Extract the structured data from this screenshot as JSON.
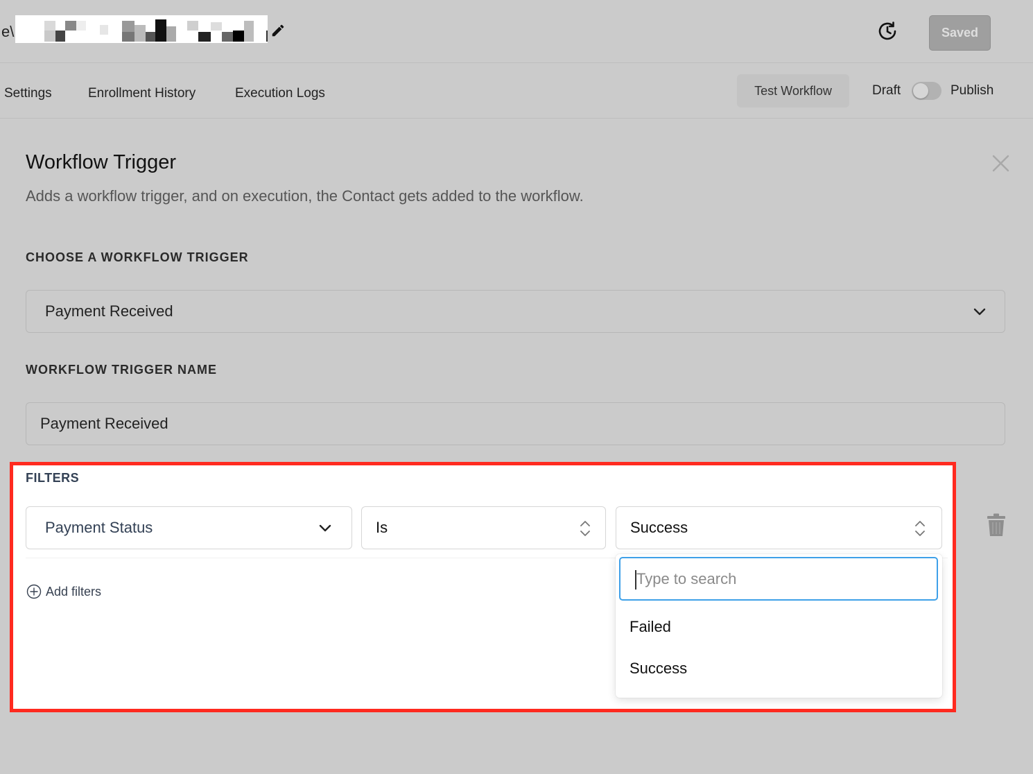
{
  "header": {
    "workflow_name_prefix": "e\\",
    "saved_label": "Saved",
    "icons": {
      "edit": "pencil-icon",
      "history": "history-icon"
    }
  },
  "tabs": [
    {
      "label": "Settings"
    },
    {
      "label": "Enrollment History"
    },
    {
      "label": "Execution Logs"
    }
  ],
  "toolbar": {
    "test_workflow_label": "Test Workflow",
    "draft_label": "Draft",
    "publish_label": "Publish",
    "published": false
  },
  "panel": {
    "title": "Workflow Trigger",
    "description": "Adds a workflow trigger, and on execution, the Contact gets added to the workflow.",
    "choose_trigger_label": "CHOOSE A WORKFLOW TRIGGER",
    "trigger_value": "Payment Received",
    "trigger_name_label": "WORKFLOW TRIGGER NAME",
    "trigger_name_value": "Payment Received"
  },
  "filters": {
    "label": "FILTERS",
    "field_value": "Payment Status",
    "operator_value": "Is",
    "value_selected": "Success",
    "add_filters_label": "Add filters",
    "dropdown": {
      "search_placeholder": "Type to search",
      "options": [
        "Failed",
        "Success"
      ]
    }
  },
  "colors": {
    "background": "#cbcbcb",
    "highlight_border": "#ff2a1f",
    "focus_border": "#3ea0e8",
    "saved_button": "#9f9f9f"
  }
}
